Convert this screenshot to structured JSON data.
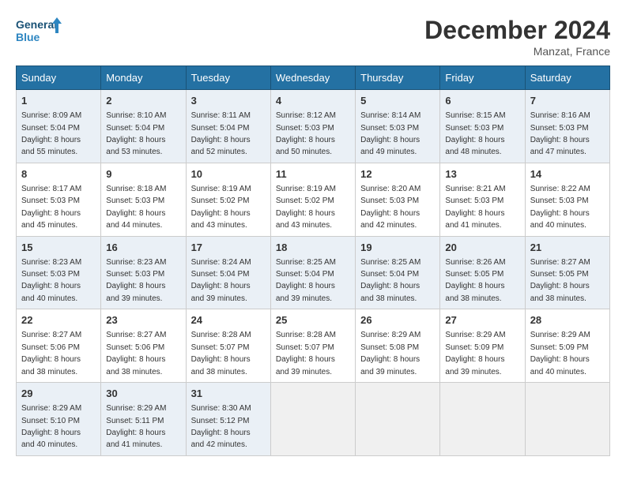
{
  "header": {
    "logo_line1": "General",
    "logo_line2": "Blue",
    "month": "December 2024",
    "location": "Manzat, France"
  },
  "days_of_week": [
    "Sunday",
    "Monday",
    "Tuesday",
    "Wednesday",
    "Thursday",
    "Friday",
    "Saturday"
  ],
  "weeks": [
    [
      {
        "day": "1",
        "sunrise": "Sunrise: 8:09 AM",
        "sunset": "Sunset: 5:04 PM",
        "daylight": "Daylight: 8 hours and 55 minutes."
      },
      {
        "day": "2",
        "sunrise": "Sunrise: 8:10 AM",
        "sunset": "Sunset: 5:04 PM",
        "daylight": "Daylight: 8 hours and 53 minutes."
      },
      {
        "day": "3",
        "sunrise": "Sunrise: 8:11 AM",
        "sunset": "Sunset: 5:04 PM",
        "daylight": "Daylight: 8 hours and 52 minutes."
      },
      {
        "day": "4",
        "sunrise": "Sunrise: 8:12 AM",
        "sunset": "Sunset: 5:03 PM",
        "daylight": "Daylight: 8 hours and 50 minutes."
      },
      {
        "day": "5",
        "sunrise": "Sunrise: 8:14 AM",
        "sunset": "Sunset: 5:03 PM",
        "daylight": "Daylight: 8 hours and 49 minutes."
      },
      {
        "day": "6",
        "sunrise": "Sunrise: 8:15 AM",
        "sunset": "Sunset: 5:03 PM",
        "daylight": "Daylight: 8 hours and 48 minutes."
      },
      {
        "day": "7",
        "sunrise": "Sunrise: 8:16 AM",
        "sunset": "Sunset: 5:03 PM",
        "daylight": "Daylight: 8 hours and 47 minutes."
      }
    ],
    [
      {
        "day": "8",
        "sunrise": "Sunrise: 8:17 AM",
        "sunset": "Sunset: 5:03 PM",
        "daylight": "Daylight: 8 hours and 45 minutes."
      },
      {
        "day": "9",
        "sunrise": "Sunrise: 8:18 AM",
        "sunset": "Sunset: 5:03 PM",
        "daylight": "Daylight: 8 hours and 44 minutes."
      },
      {
        "day": "10",
        "sunrise": "Sunrise: 8:19 AM",
        "sunset": "Sunset: 5:02 PM",
        "daylight": "Daylight: 8 hours and 43 minutes."
      },
      {
        "day": "11",
        "sunrise": "Sunrise: 8:19 AM",
        "sunset": "Sunset: 5:02 PM",
        "daylight": "Daylight: 8 hours and 43 minutes."
      },
      {
        "day": "12",
        "sunrise": "Sunrise: 8:20 AM",
        "sunset": "Sunset: 5:03 PM",
        "daylight": "Daylight: 8 hours and 42 minutes."
      },
      {
        "day": "13",
        "sunrise": "Sunrise: 8:21 AM",
        "sunset": "Sunset: 5:03 PM",
        "daylight": "Daylight: 8 hours and 41 minutes."
      },
      {
        "day": "14",
        "sunrise": "Sunrise: 8:22 AM",
        "sunset": "Sunset: 5:03 PM",
        "daylight": "Daylight: 8 hours and 40 minutes."
      }
    ],
    [
      {
        "day": "15",
        "sunrise": "Sunrise: 8:23 AM",
        "sunset": "Sunset: 5:03 PM",
        "daylight": "Daylight: 8 hours and 40 minutes."
      },
      {
        "day": "16",
        "sunrise": "Sunrise: 8:23 AM",
        "sunset": "Sunset: 5:03 PM",
        "daylight": "Daylight: 8 hours and 39 minutes."
      },
      {
        "day": "17",
        "sunrise": "Sunrise: 8:24 AM",
        "sunset": "Sunset: 5:04 PM",
        "daylight": "Daylight: 8 hours and 39 minutes."
      },
      {
        "day": "18",
        "sunrise": "Sunrise: 8:25 AM",
        "sunset": "Sunset: 5:04 PM",
        "daylight": "Daylight: 8 hours and 39 minutes."
      },
      {
        "day": "19",
        "sunrise": "Sunrise: 8:25 AM",
        "sunset": "Sunset: 5:04 PM",
        "daylight": "Daylight: 8 hours and 38 minutes."
      },
      {
        "day": "20",
        "sunrise": "Sunrise: 8:26 AM",
        "sunset": "Sunset: 5:05 PM",
        "daylight": "Daylight: 8 hours and 38 minutes."
      },
      {
        "day": "21",
        "sunrise": "Sunrise: 8:27 AM",
        "sunset": "Sunset: 5:05 PM",
        "daylight": "Daylight: 8 hours and 38 minutes."
      }
    ],
    [
      {
        "day": "22",
        "sunrise": "Sunrise: 8:27 AM",
        "sunset": "Sunset: 5:06 PM",
        "daylight": "Daylight: 8 hours and 38 minutes."
      },
      {
        "day": "23",
        "sunrise": "Sunrise: 8:27 AM",
        "sunset": "Sunset: 5:06 PM",
        "daylight": "Daylight: 8 hours and 38 minutes."
      },
      {
        "day": "24",
        "sunrise": "Sunrise: 8:28 AM",
        "sunset": "Sunset: 5:07 PM",
        "daylight": "Daylight: 8 hours and 38 minutes."
      },
      {
        "day": "25",
        "sunrise": "Sunrise: 8:28 AM",
        "sunset": "Sunset: 5:07 PM",
        "daylight": "Daylight: 8 hours and 39 minutes."
      },
      {
        "day": "26",
        "sunrise": "Sunrise: 8:29 AM",
        "sunset": "Sunset: 5:08 PM",
        "daylight": "Daylight: 8 hours and 39 minutes."
      },
      {
        "day": "27",
        "sunrise": "Sunrise: 8:29 AM",
        "sunset": "Sunset: 5:09 PM",
        "daylight": "Daylight: 8 hours and 39 minutes."
      },
      {
        "day": "28",
        "sunrise": "Sunrise: 8:29 AM",
        "sunset": "Sunset: 5:09 PM",
        "daylight": "Daylight: 8 hours and 40 minutes."
      }
    ],
    [
      {
        "day": "29",
        "sunrise": "Sunrise: 8:29 AM",
        "sunset": "Sunset: 5:10 PM",
        "daylight": "Daylight: 8 hours and 40 minutes."
      },
      {
        "day": "30",
        "sunrise": "Sunrise: 8:29 AM",
        "sunset": "Sunset: 5:11 PM",
        "daylight": "Daylight: 8 hours and 41 minutes."
      },
      {
        "day": "31",
        "sunrise": "Sunrise: 8:30 AM",
        "sunset": "Sunset: 5:12 PM",
        "daylight": "Daylight: 8 hours and 42 minutes."
      },
      null,
      null,
      null,
      null
    ]
  ]
}
